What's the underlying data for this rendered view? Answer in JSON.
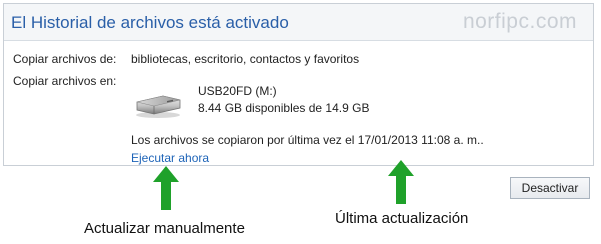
{
  "header": {
    "title": "El Historial de archivos está activado",
    "watermark": "norfipc.com"
  },
  "details": {
    "copy_what_label": "Copiar archivos de:",
    "copy_what_value": "bibliotecas, escritorio, contactos y favoritos",
    "copy_where_label": "Copiar archivos en:"
  },
  "drive": {
    "icon": "usb-drive-icon",
    "name": "USB20FD (M:)",
    "space": "8.44 GB disponibles de 14.9 GB"
  },
  "status": {
    "last_copy": "Los archivos se copiaron por última vez el 17/01/2013 11:08 a. m..",
    "run_now_link": "Ejecutar ahora"
  },
  "actions": {
    "stop_button": "Desactivar"
  },
  "annotations": {
    "manual_update": "Actualizar manualmente",
    "last_update": "Última actualización",
    "arrow_color": "#1fa12a",
    "arrow_icon": "up-arrow-icon"
  },
  "colors": {
    "title": "#2a5fa8",
    "link": "#1e64b8"
  }
}
